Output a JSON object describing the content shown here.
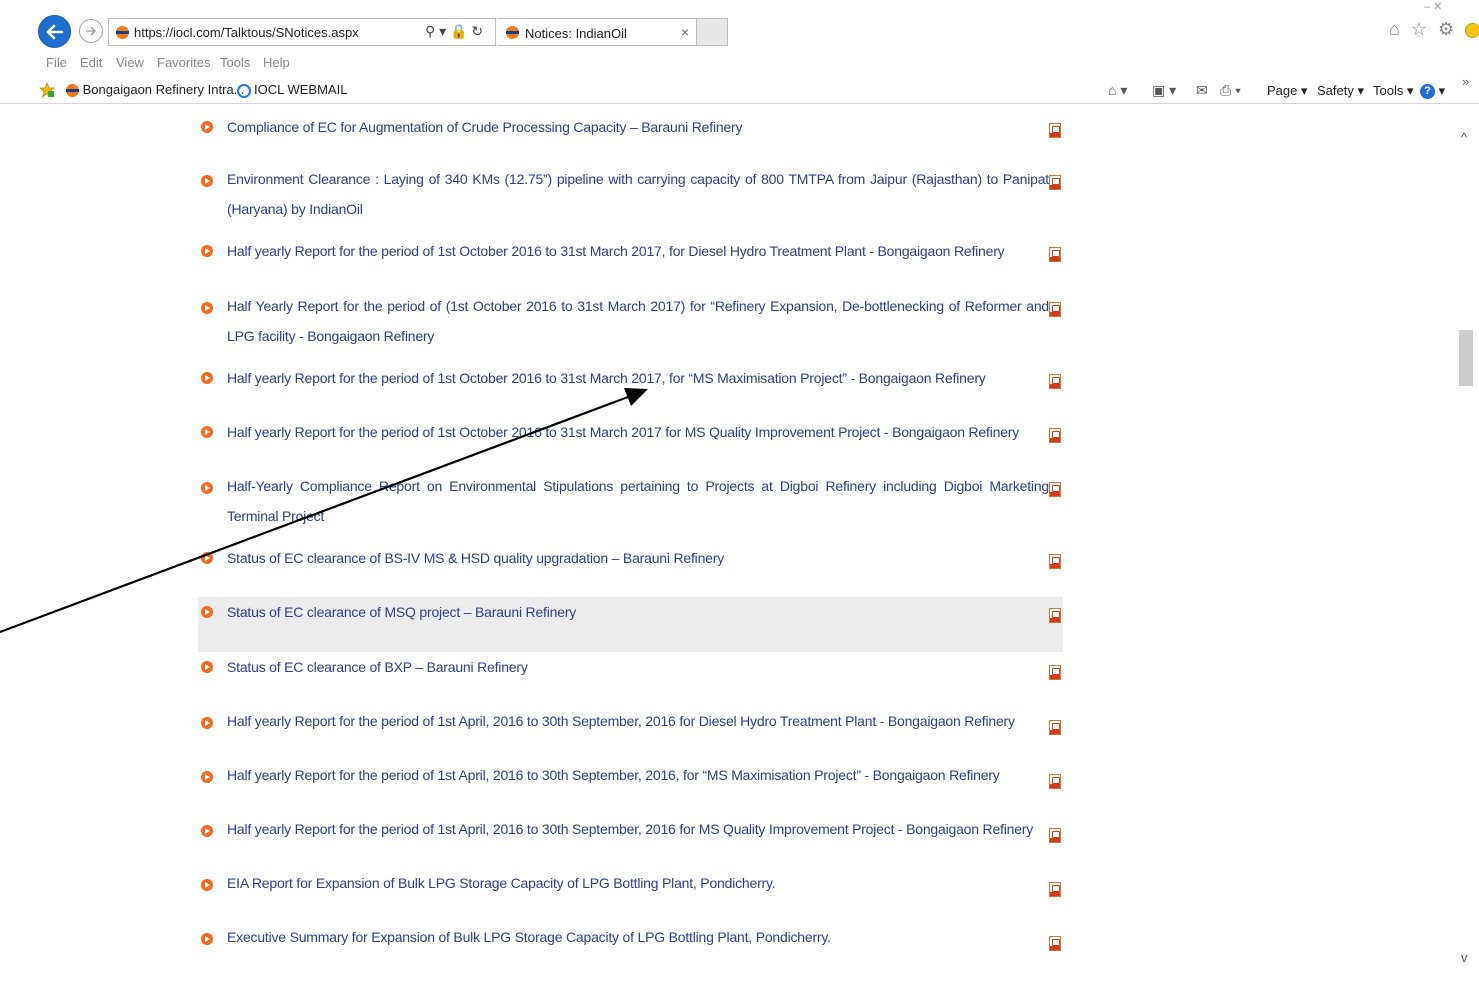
{
  "browser": {
    "url": "https://iocl.com/Talktous/SNotices.aspx",
    "tab_title": "Notices: IndianOil",
    "tab_close": "×",
    "address_tools": "⚲ ▾ 🔒 ↻",
    "window_controls": "–   ✕",
    "right_icons": "⌂ ☆ ⚙",
    "chevron": "»"
  },
  "menu": {
    "file": "File",
    "edit": "Edit",
    "view": "View",
    "favorites": "Favorites",
    "tools": "Tools",
    "help": "Help"
  },
  "favorites_bar": {
    "items": [
      {
        "label": "Bongaigaon Refinery Intra..."
      },
      {
        "label": "IOCL WEBMAIL"
      }
    ]
  },
  "command_bar": {
    "page": "Page ▾",
    "safety": "Safety ▾",
    "tools": "Tools ▾",
    "help": "?"
  },
  "notices": [
    {
      "text": "Compliance of EC for Augmentation of Crude Processing Capacity – Barauni Refinery"
    },
    {
      "text": "Environment Clearance : Laying of 340 KMs (12.75”) pipeline with carrying capacity of 800 TMTPA from Jaipur (Rajasthan) to Panipat (Haryana) by IndianOil"
    },
    {
      "text": "Half yearly Report for the period of 1st October 2016 to 31st March 2017, for Diesel Hydro Treatment Plant - Bongaigaon Refinery"
    },
    {
      "text": "Half Yearly Report for the period of (1st October 2016 to 31st March 2017) for “Refinery Expansion, De-bottlenecking of Reformer and LPG facility - Bongaigaon Refinery"
    },
    {
      "text": "Half yearly Report for the period of 1st October 2016 to 31st March 2017, for “MS Maximisation Project” - Bongaigaon Refinery"
    },
    {
      "text": "Half yearly Report for the period of 1st October 2016 to 31st March 2017 for MS Quality Improvement Project - Bongaigaon Refinery"
    },
    {
      "text": "Half-Yearly Compliance Report on Environmental Stipulations pertaining to Projects at Digboi Refinery including Digboi Marketing Terminal Project"
    },
    {
      "text": "Status of EC clearance of BS-IV MS & HSD quality upgradation – Barauni Refinery"
    },
    {
      "text": "Status of EC clearance of MSQ project – Barauni Refinery"
    },
    {
      "text": "Status of EC clearance of BXP – Barauni Refinery"
    },
    {
      "text": "Half yearly Report for the period of 1st April, 2016 to 30th September, 2016 for Diesel Hydro Treatment Plant - Bongaigaon Refinery"
    },
    {
      "text": "Half yearly Report for the period of 1st April, 2016 to 30th September, 2016, for “MS Maximisation Project” - Bongaigaon Refinery"
    },
    {
      "text": "Half yearly Report for the period of 1st April, 2016 to 30th September, 2016 for MS Quality Improvement Project - Bongaigaon Refinery"
    },
    {
      "text": "EIA Report for Expansion of Bulk LPG Storage Capacity of LPG Bottling Plant, Pondicherry."
    },
    {
      "text": "Executive Summary for Expansion of Bulk LPG Storage Capacity of LPG Bottling Plant, Pondicherry."
    }
  ],
  "scrollbar": {
    "up": "^",
    "down": "v"
  },
  "colors": {
    "link": "#2b3f8c",
    "bullet": "#f26b1f",
    "highlight_row": "#ececec"
  }
}
